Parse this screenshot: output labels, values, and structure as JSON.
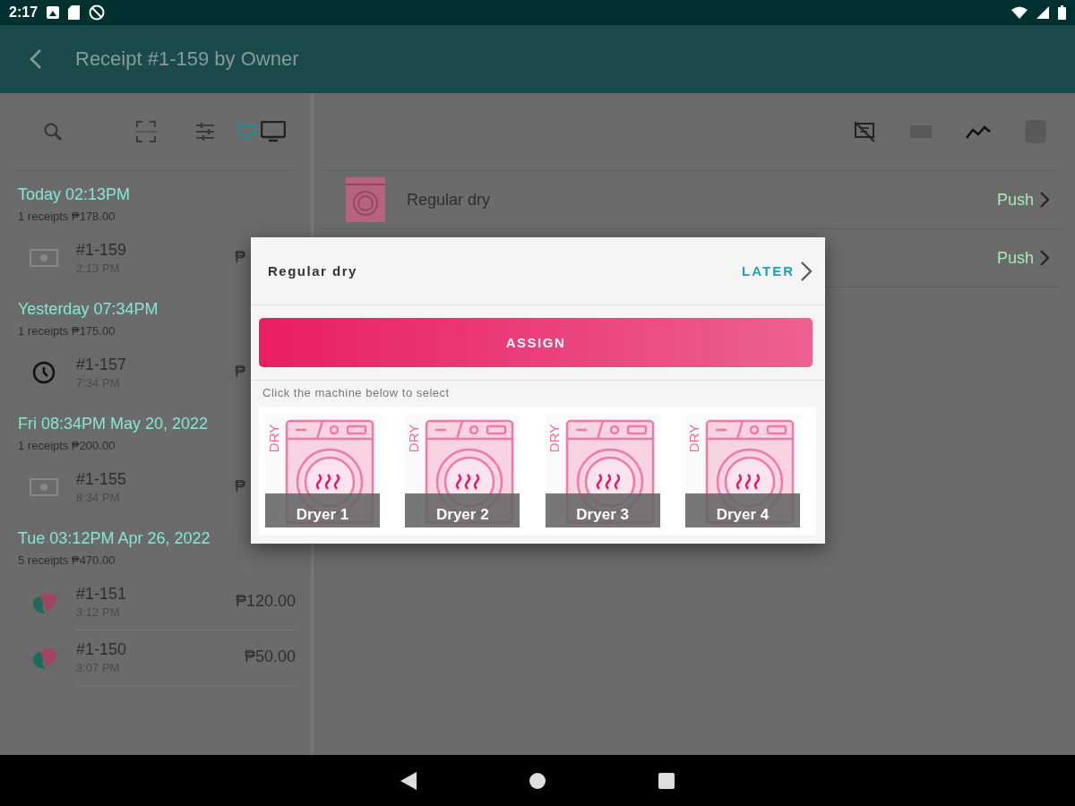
{
  "status_bar": {
    "time": "2:17"
  },
  "app_bar": {
    "title": "Receipt #1-159 by Owner"
  },
  "groups": [
    {
      "title": "Today 02:13PM",
      "summary": "1 receipts ₱178.00",
      "receipts": [
        {
          "number": "#1-159",
          "time": "2:13 PM",
          "amount": "₱",
          "kind": "cash"
        }
      ]
    },
    {
      "title": "Yesterday 07:34PM",
      "summary": "1 receipts ₱175.00",
      "receipts": [
        {
          "number": "#1-157",
          "time": "7:34 PM",
          "amount": "₱",
          "kind": "clock"
        }
      ]
    },
    {
      "title": "Fri 08:34PM May 20, 2022",
      "summary": "1 receipts ₱200.00",
      "receipts": [
        {
          "number": "#1-155",
          "time": "8:34 PM",
          "amount": "₱",
          "kind": "cash"
        }
      ]
    },
    {
      "title": "Tue 03:12PM Apr 26, 2022",
      "summary": "5 receipts ₱470.00",
      "receipts": [
        {
          "number": "#1-151",
          "time": "3:12 PM",
          "amount": "₱120.00",
          "kind": "app"
        },
        {
          "number": "#1-150",
          "time": "3:07 PM",
          "amount": "₱50.00",
          "kind": "app"
        }
      ]
    }
  ],
  "items": [
    {
      "name": "Regular dry",
      "action": "Push"
    },
    {
      "action": "Push"
    }
  ],
  "dialog": {
    "title": "Regular dry",
    "later": "LATER",
    "assign": "ASSIGN",
    "hint": "Click the machine below to select",
    "machines": [
      {
        "tag": "DRY",
        "label": "Dryer 1"
      },
      {
        "tag": "DRY",
        "label": "Dryer 2"
      },
      {
        "tag": "DRY",
        "label": "Dryer 3"
      },
      {
        "tag": "DRY",
        "label": "Dryer 4"
      }
    ]
  }
}
